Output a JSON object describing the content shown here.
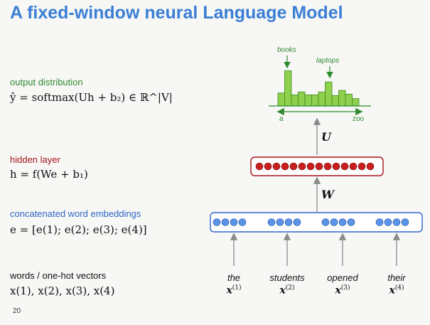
{
  "title": "A fixed-window neural Language Model",
  "page_number": "20",
  "output": {
    "label": "output distribution",
    "equation": "ŷ = softmax(Uh + b₂) ∈ ℝ^|V|"
  },
  "hidden": {
    "label": "hidden layer",
    "equation": "h = f(We + b₁)"
  },
  "embeddings": {
    "label": "concatenated word embeddings",
    "equation": "e = [e(1); e(2); e(3); e(4)]"
  },
  "words_section": {
    "label": "words / one-hot vectors",
    "equation": "x(1), x(2), x(3), x(4)"
  },
  "words": [
    {
      "text": "the",
      "var": "x",
      "sup": "(1)"
    },
    {
      "text": "students",
      "var": "x",
      "sup": "(2)"
    },
    {
      "text": "opened",
      "var": "x",
      "sup": "(3)"
    },
    {
      "text": "their",
      "var": "x",
      "sup": "(4)"
    }
  ],
  "weights": {
    "W": "W",
    "U": "U"
  },
  "histogram": {
    "axis_left": "a",
    "axis_right": "zoo",
    "annotation_books": "books",
    "annotation_laptops": "laptops",
    "values": [
      0.35,
      0.95,
      0.3,
      0.38,
      0.3,
      0.3,
      0.38,
      0.65,
      0.28,
      0.42,
      0.32,
      0.2
    ],
    "highlight_books_index": 1,
    "highlight_laptops_index": 7
  },
  "colors": {
    "title": "#3a7fd5",
    "output_label": "#2f8a2f",
    "hidden_label": "#a4141a",
    "embed_label": "#2e66c7",
    "bar_fill": "#8fd14f",
    "bar_stroke": "#3d8a1c",
    "hidden_unit": "#c81e1e",
    "embed_unit": "#5b93e6",
    "arrow": "#8a8a8a"
  }
}
